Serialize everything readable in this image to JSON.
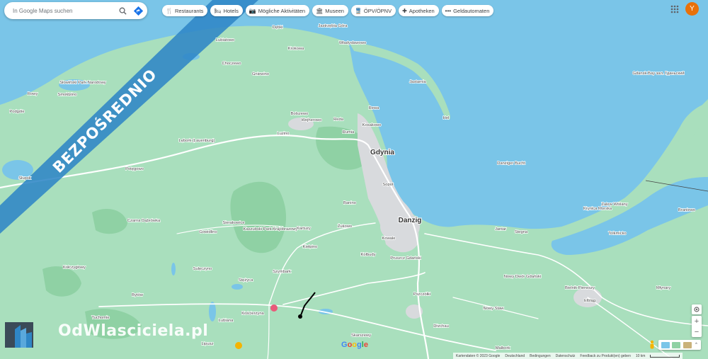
{
  "search": {
    "placeholder": "In Google Maps suchen"
  },
  "chips": [
    {
      "icon": "restaurant-icon",
      "glyph": "🍴",
      "label": "Restaurants"
    },
    {
      "icon": "hotel-icon",
      "glyph": "🛏",
      "label": "Hotels"
    },
    {
      "icon": "camera-icon",
      "glyph": "📷",
      "label": "Mögliche Aktivitäten"
    },
    {
      "icon": "museum-icon",
      "glyph": "🏛",
      "label": "Museen"
    },
    {
      "icon": "transit-icon",
      "glyph": "🚆",
      "label": "ÖPV/ÖPNV"
    },
    {
      "icon": "pharmacy-icon",
      "glyph": "✚",
      "label": "Apotheken"
    },
    {
      "icon": "atm-icon",
      "glyph": "•••",
      "label": "Geldautomaten"
    }
  ],
  "user": {
    "avatar_letter": "Y"
  },
  "banner": {
    "text": "BEZPOŚREDNIO",
    "color": "#2f86c6"
  },
  "brand": {
    "text": "OdWlasciciela.pl"
  },
  "minimap_label": "",
  "controls": {
    "zoom_in": "+",
    "zoom_out": "−"
  },
  "footer": {
    "items": [
      "Kartendaten © 2023 Google",
      "Deutschland",
      "Bedingungen",
      "Datenschutz",
      "Feedback zu Produkt(en) geben"
    ],
    "scale": "10 km"
  },
  "google_logo": "Google",
  "colors": {
    "land": "#a9dfbd",
    "water": "#7ac5e8",
    "forest": "#8fd1a4",
    "urban": "#d8dadd",
    "road": "#ffffff",
    "brand_blue": "#2f86c6"
  },
  "places": [
    {
      "name": "Dębki",
      "big": false
    },
    {
      "name": "Jastrzębia Góra",
      "big": false
    },
    {
      "name": "Lubiatowo",
      "big": false
    },
    {
      "name": "Krokowa",
      "big": false
    },
    {
      "name": "Władysławowo",
      "big": false
    },
    {
      "name": "Choczewo",
      "big": false
    },
    {
      "name": "Gniewino",
      "big": false
    },
    {
      "name": "Słowiński Park Narodowy",
      "big": false
    },
    {
      "name": "Rowy",
      "big": false
    },
    {
      "name": "Podgóle",
      "big": false
    },
    {
      "name": "Smołdzino",
      "big": false
    },
    {
      "name": "Jastarnia",
      "big": false
    },
    {
      "name": "Hel",
      "big": false
    },
    {
      "name": "Rewa",
      "big": false
    },
    {
      "name": "Bolszewo",
      "big": false
    },
    {
      "name": "Wejherowo",
      "big": false
    },
    {
      "name": "Reda",
      "big": false
    },
    {
      "name": "Rumia",
      "big": false
    },
    {
      "name": "Kosakowo",
      "big": false
    },
    {
      "name": "Gdynia",
      "big": true
    },
    {
      "name": "Lębork (Lauenburg)",
      "big": false
    },
    {
      "name": "Luzino",
      "big": false
    },
    {
      "name": "Słupsk",
      "big": false
    },
    {
      "name": "Potęgowo",
      "big": false
    },
    {
      "name": "Sopot",
      "big": false
    },
    {
      "name": "Banino",
      "big": false
    },
    {
      "name": "Danzig",
      "big": true
    },
    {
      "name": "Czarna Dąbrówka",
      "big": false
    },
    {
      "name": "Sierakowice",
      "big": false
    },
    {
      "name": "Kaszubski Park Krajobrazowy",
      "big": false
    },
    {
      "name": "Kartuzy",
      "big": false
    },
    {
      "name": "Żukowo",
      "big": false
    },
    {
      "name": "Gowidlino",
      "big": false
    },
    {
      "name": "Kiełpino",
      "big": false
    },
    {
      "name": "Kolbudy",
      "big": false
    },
    {
      "name": "Kowale",
      "big": false
    },
    {
      "name": "Pruszcz Gdański",
      "big": false
    },
    {
      "name": "Jantar",
      "big": false
    },
    {
      "name": "Stegna",
      "big": false
    },
    {
      "name": "Krynica Morska",
      "big": false
    },
    {
      "name": "Tolkmicko",
      "big": false
    },
    {
      "name": "Braniewo",
      "big": false
    },
    {
      "name": "Kołczygłowy",
      "big": false
    },
    {
      "name": "Sulęczyno",
      "big": false
    },
    {
      "name": "Szymbark",
      "big": false
    },
    {
      "name": "Stężyca",
      "big": false
    },
    {
      "name": "Bytów",
      "big": false
    },
    {
      "name": "Pszczółki",
      "big": false
    },
    {
      "name": "Nowy Dwór Gdański",
      "big": false
    },
    {
      "name": "Bielnik Pierwszy",
      "big": false
    },
    {
      "name": "Młynary",
      "big": false
    },
    {
      "name": "Kościerzyna",
      "big": false
    },
    {
      "name": "Tuchomie",
      "big": false
    },
    {
      "name": "Lubiana",
      "big": false
    },
    {
      "name": "Nowy Staw",
      "big": false
    },
    {
      "name": "Elbląg",
      "big": false
    },
    {
      "name": "Lipusz",
      "big": false
    },
    {
      "name": "Skarszewy",
      "big": false
    },
    {
      "name": "Tczew",
      "big": false
    },
    {
      "name": "Malbork",
      "big": false
    },
    {
      "name": "Gdansk Bay зал. Гданьский",
      "big": false
    },
    {
      "name": "Danziger Bucht",
      "big": false
    },
    {
      "name": "Zalew Wiślany",
      "big": false
    },
    {
      "name": "Drzchau",
      "big": false
    }
  ]
}
